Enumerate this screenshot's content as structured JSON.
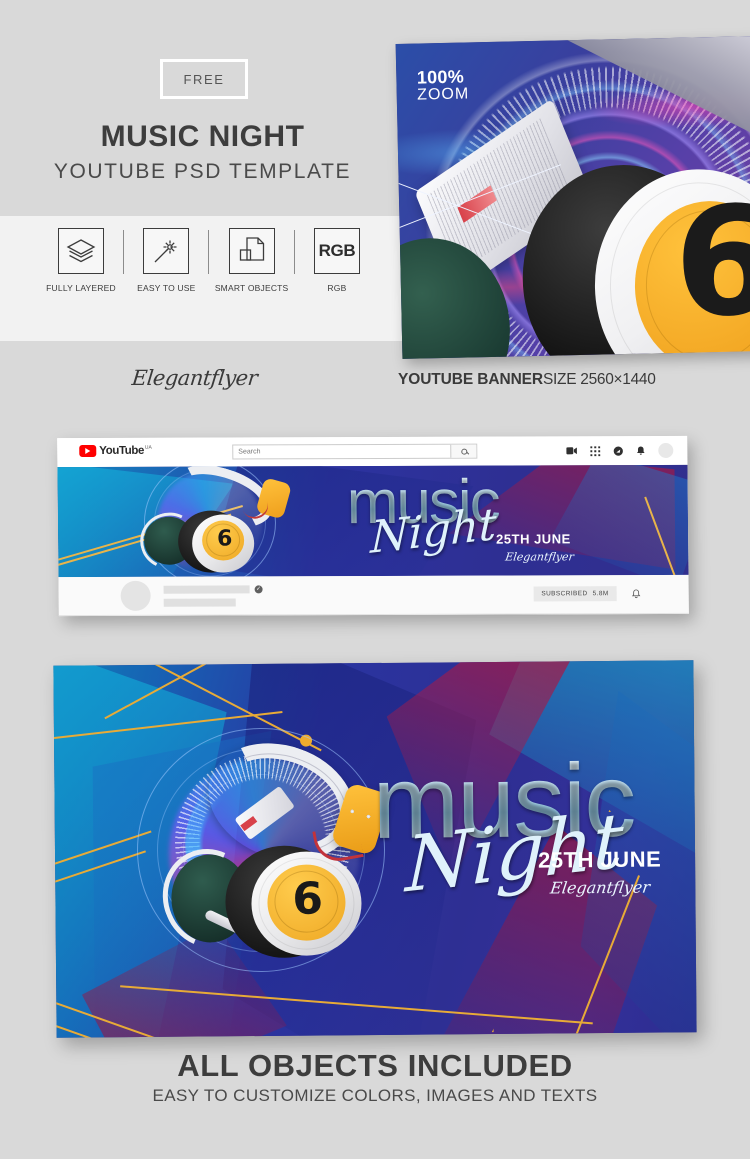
{
  "page": {
    "background": "#d9d9d9",
    "strip_background": "#f2f2f2"
  },
  "header": {
    "badge": "FREE",
    "title": "MUSIC NIGHT",
    "subtitle": "YOUTUBE PSD TEMPLATE"
  },
  "features": [
    {
      "icon": "layers-icon",
      "label": "FULLY LAYERED"
    },
    {
      "icon": "magic-wand-icon",
      "label": "EASY TO USE"
    },
    {
      "icon": "smart-objects-icon",
      "label": "SMART OBJECTS"
    },
    {
      "icon": "rgb-icon",
      "label": "RGB",
      "box_text": "RGB"
    }
  ],
  "zoom_preview": {
    "line1": "100%",
    "line2": "ZOOM"
  },
  "caption": {
    "brand": "Elegantflyer",
    "banner_label": "YOUTUBE BANNER",
    "banner_size": "SIZE 2560×1440"
  },
  "youtube": {
    "logo_word": "YouTube",
    "logo_country": "UA",
    "search_placeholder": "Search",
    "search_value": "",
    "icons": [
      "video-camera-icon",
      "apps-grid-icon",
      "messages-icon",
      "bell-icon",
      "avatar"
    ],
    "channel": {
      "verified_glyph": "✓",
      "subscribed_label": "SUBSCRIBED",
      "subscriber_count": "5.8M",
      "bell_icon": "bell-icon"
    }
  },
  "banner_art": {
    "music": "music",
    "night": "Night",
    "date": "25TH JUNE",
    "brand": "Elegantflyer",
    "headphone_badge": "6",
    "colors": {
      "deep_blue": "#2a2b8c",
      "royal_blue": "#343fa3",
      "cyan": "#1a8fc1",
      "crimson": "#a01f4a",
      "gold": "#e8a93a",
      "navy": "#1b2270"
    }
  },
  "footer": {
    "title": "ALL OBJECTS INCLUDED",
    "subtitle": "EASY TO CUSTOMIZE COLORS, IMAGES AND TEXTS"
  }
}
